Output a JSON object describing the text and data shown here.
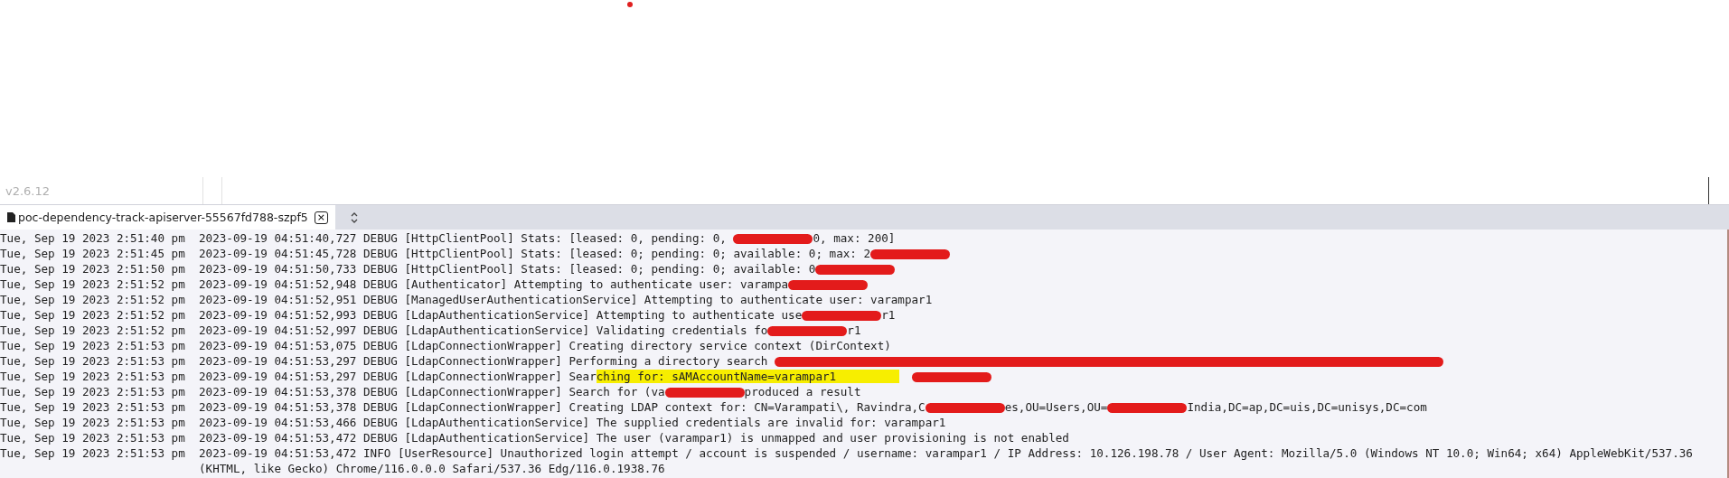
{
  "version": "v2.6.12",
  "tab": {
    "label": "poc-dependency-track-apiserver-55567fd788-szpf5",
    "close": "×"
  },
  "lines": [
    {
      "time": "Tue, Sep 19 2023 2:51:40 pm",
      "parts": [
        {
          "kind": "text",
          "text": "2023-09-19 04:51:40,727 DEBUG [HttpClientPool] Stats: [leased: 0, pending: 0, "
        },
        {
          "kind": "redaction"
        },
        {
          "kind": "text",
          "text": "0, max: 200]"
        }
      ]
    },
    {
      "time": "Tue, Sep 19 2023 2:51:45 pm",
      "parts": [
        {
          "kind": "text",
          "text": "2023-09-19 04:51:45,728 DEBUG [HttpClientPool] Stats: [leased: 0; pending: 0; available: 0; max: 2"
        },
        {
          "kind": "redaction"
        }
      ]
    },
    {
      "time": "Tue, Sep 19 2023 2:51:50 pm",
      "parts": [
        {
          "kind": "text",
          "text": "2023-09-19 04:51:50,733 DEBUG [HttpClientPool] Stats: [leased: 0; pending: 0; available: 0"
        },
        {
          "kind": "redaction"
        }
      ]
    },
    {
      "time": "Tue, Sep 19 2023 2:51:52 pm",
      "parts": [
        {
          "kind": "text",
          "text": "2023-09-19 04:51:52,948 DEBUG [Authenticator] Attempting to authenticate user: varampa"
        },
        {
          "kind": "redaction"
        }
      ]
    },
    {
      "time": "Tue, Sep 19 2023 2:51:52 pm",
      "parts": [
        {
          "kind": "text",
          "text": "2023-09-19 04:51:52,951 DEBUG [ManagedUserAuthenticationService] Attempting to authenticate user: varampar1"
        }
      ]
    },
    {
      "time": "Tue, Sep 19 2023 2:51:52 pm",
      "parts": [
        {
          "kind": "text",
          "text": "2023-09-19 04:51:52,993 DEBUG [LdapAuthenticationService] Attempting to authenticate use"
        },
        {
          "kind": "redaction"
        },
        {
          "kind": "text",
          "text": "r1"
        }
      ]
    },
    {
      "time": "Tue, Sep 19 2023 2:51:52 pm",
      "parts": [
        {
          "kind": "text",
          "text": "2023-09-19 04:51:52,997 DEBUG [LdapAuthenticationService] Validating credentials fo"
        },
        {
          "kind": "redaction"
        },
        {
          "kind": "text",
          "text": "r1"
        }
      ]
    },
    {
      "time": "Tue, Sep 19 2023 2:51:53 pm",
      "parts": [
        {
          "kind": "text",
          "text": "2023-09-19 04:51:53,075 DEBUG [LdapConnectionWrapper] Creating directory service context (DirContext)"
        }
      ]
    },
    {
      "time": "Tue, Sep 19 2023 2:51:53 pm",
      "parts": [
        {
          "kind": "text",
          "text": "2023-09-19 04:51:53,297 DEBUG [LdapConnectionWrapper] Performing a directory search "
        },
        {
          "kind": "long-redaction"
        }
      ]
    },
    {
      "time": "Tue, Sep 19 2023 2:51:53 pm",
      "parts": [
        {
          "kind": "text",
          "text": "2023-09-19 04:51:53,297 DEBUG [LdapConnectionWrapper] Sear"
        },
        {
          "kind": "highlight",
          "text": "ching for: sAMAccountName=varampar1"
        },
        {
          "kind": "redaction"
        }
      ]
    },
    {
      "time": "Tue, Sep 19 2023 2:51:53 pm",
      "parts": [
        {
          "kind": "text",
          "text": "2023-09-19 04:51:53,378 DEBUG [LdapConnectionWrapper] Search for (va"
        },
        {
          "kind": "redaction"
        },
        {
          "kind": "text",
          "text": "produced a result"
        }
      ]
    },
    {
      "time": "Tue, Sep 19 2023 2:51:53 pm",
      "parts": [
        {
          "kind": "text",
          "text": "2023-09-19 04:51:53,378 DEBUG [LdapConnectionWrapper] Creating LDAP context for: CN=Varampati\\, Ravindra,C"
        },
        {
          "kind": "redaction"
        },
        {
          "kind": "text",
          "text": "es,OU=Users,OU="
        },
        {
          "kind": "redaction"
        },
        {
          "kind": "text",
          "text": "India,DC=ap,DC=uis,DC=unisys,DC=com"
        }
      ]
    },
    {
      "time": "Tue, Sep 19 2023 2:51:53 pm",
      "parts": [
        {
          "kind": "text",
          "text": "2023-09-19 04:51:53,466 DEBUG [LdapAuthenticationService] The supplied credentials are invalid for: varampar1"
        }
      ]
    },
    {
      "time": "Tue, Sep 19 2023 2:51:53 pm",
      "parts": [
        {
          "kind": "text",
          "text": "2023-09-19 04:51:53,472 DEBUG [LdapAuthenticationService] The user (varampar1) is unmapped and user provisioning is not enabled"
        }
      ]
    },
    {
      "time": "Tue, Sep 19 2023 2:51:53 pm",
      "parts": [
        {
          "kind": "text",
          "text": "2023-09-19 04:51:53,472 INFO [UserResource] Unauthorized login attempt / account is suspended / username: varampar1 / IP Address: 10.126.198.78 / User Agent: Mozilla/5.0 (Windows NT 10.0; Win64; x64) AppleWebKit/537.36"
        },
        {
          "kind": "break"
        },
        {
          "kind": "text",
          "text": "(KHTML, like Gecko) Chrome/116.0.0.0 Safari/537.36 Edg/116.0.1938.76"
        }
      ]
    }
  ]
}
